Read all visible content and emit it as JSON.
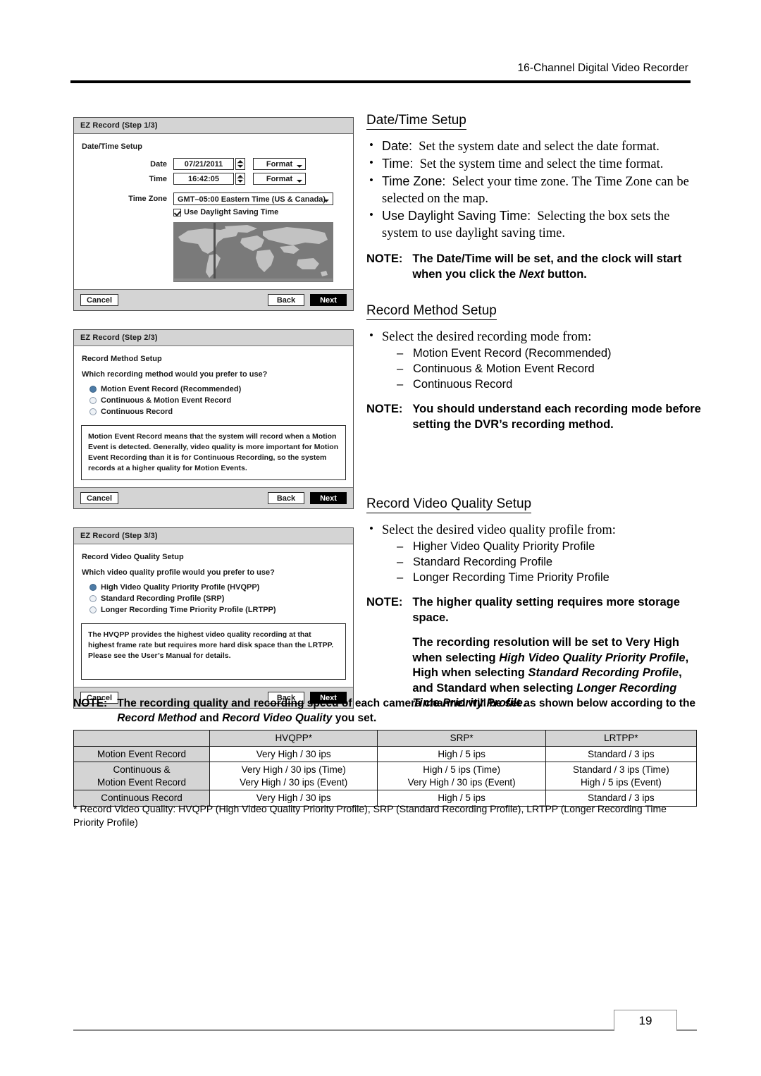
{
  "header": {
    "title": "16-Channel Digital Video Recorder"
  },
  "dialogs": [
    {
      "title": "EZ Record (Step 1/3)",
      "heading": "Date/Time Setup",
      "fields": {
        "date_label": "Date",
        "date_value": "07/21/2011",
        "time_label": "Time",
        "time_value": "16:42:05",
        "format_button": "Format",
        "timezone_label": "Time Zone",
        "timezone_value": "GMT–05:00  Eastern Time (US & Canada)",
        "dst_label": "Use Daylight Saving Time"
      },
      "buttons": {
        "cancel": "Cancel",
        "back": "Back",
        "next": "Next"
      }
    },
    {
      "title": "EZ Record (Step 2/3)",
      "heading": "Record Method Setup",
      "question": "Which recording method would you prefer to use?",
      "options": [
        {
          "label": "Motion Event Record (Recommended)",
          "selected": true
        },
        {
          "label": "Continuous & Motion Event Record",
          "selected": false
        },
        {
          "label": "Continuous Record",
          "selected": false
        }
      ],
      "description": "Motion Event Record means that the system will record when a Motion Event is detected. Generally, video quality is more important for Motion Event Recording than it is for Continuous Recording, so the system records at a higher quality for Motion Events.",
      "buttons": {
        "cancel": "Cancel",
        "back": "Back",
        "next": "Next"
      }
    },
    {
      "title": "EZ Record (Step 3/3)",
      "heading": "Record Video Quality Setup",
      "question": "Which video quality profile would you prefer to use?",
      "options": [
        {
          "label": "High Video Quality Priority Profile (HVQPP)",
          "selected": true
        },
        {
          "label": "Standard Recording Profile (SRP)",
          "selected": false
        },
        {
          "label": "Longer Recording Time Priority Profile (LRTPP)",
          "selected": false
        }
      ],
      "description": "The HVQPP provides the highest video quality recording at that highest frame rate but requires more hard disk space than the LRTPP. Please see the User’s Manual for details.",
      "buttons": {
        "cancel": "Cancel",
        "back": "Back",
        "next": "Next"
      }
    }
  ],
  "sections": [
    {
      "title": "Date/Time Setup",
      "bullets": [
        {
          "term": "Date:",
          "text": "Set the system date and select the date format."
        },
        {
          "term": "Time:",
          "text": "Set the system time and select the time format."
        },
        {
          "term": "Time Zone:",
          "text": "Select your time zone.  The Time Zone can be selected on the map."
        },
        {
          "term": "Use Daylight Saving Time:",
          "text": "Selecting the box sets the system to use daylight saving time."
        }
      ],
      "note_label": "NOTE:",
      "note_a": "The Date/Time will be set, and the clock will start when you click the ",
      "note_em": "Next",
      "note_b": " button."
    },
    {
      "title": "Record Method Setup",
      "lead": "Select the desired recording mode from:",
      "sub": [
        "Motion Event Record (Recommended)",
        "Continuous & Motion Event Record",
        "Continuous Record"
      ],
      "note_label": "NOTE:",
      "note_text": "You should understand each recording mode before setting the DVR’s recording method."
    },
    {
      "title": "Record Video Quality Setup",
      "lead": "Select the desired video quality profile from:",
      "sub": [
        "Higher Video Quality Priority Profile",
        "Standard Recording Profile",
        "Longer Recording Time Priority Profile"
      ],
      "note_label": "NOTE:",
      "note_p1": "The higher quality setting requires more storage space.",
      "note_p2_a": "The recording resolution will be set to Very High when selecting ",
      "note_p2_em1": "High Video Quality Priority Profile",
      "note_p2_b": ", High when selecting ",
      "note_p2_em2": "Standard Recording Profile",
      "note_p2_c": ", and Standard when selecting ",
      "note_p2_em3": "Longer Recording Time Priority Profile",
      "note_p2_d": "."
    }
  ],
  "bottom_note": {
    "label": "NOTE:",
    "a": "The recording quality and recording speed of each camera channel will be set as shown below according to the ",
    "em1": "Record Method",
    "b": " and ",
    "em2": "Record Video Quality",
    "c": " you set."
  },
  "table": {
    "columns": [
      "",
      "HVQPP*",
      "SRP*",
      "LRTPP*"
    ],
    "rows": [
      {
        "head": [
          "Motion Event Record"
        ],
        "cells": [
          [
            "Very High / 30 ips"
          ],
          [
            "High / 5 ips"
          ],
          [
            "Standard / 3 ips"
          ]
        ]
      },
      {
        "head": [
          "Continuous &",
          "Motion Event Record"
        ],
        "cells": [
          [
            "Very High / 30 ips (Time)",
            "Very High / 30 ips (Event)"
          ],
          [
            "High / 5 ips (Time)",
            "Very High / 30 ips (Event)"
          ],
          [
            "Standard / 3 ips (Time)",
            "High / 5 ips (Event)"
          ]
        ]
      },
      {
        "head": [
          "Continuous Record"
        ],
        "cells": [
          [
            "Very High / 30 ips"
          ],
          [
            "High / 5 ips"
          ],
          [
            "Standard / 3 ips"
          ]
        ]
      }
    ]
  },
  "footnote": "* Record Video Quality: HVQPP (High Video Quality Priority Profile), SRP (Standard Recording Profile), LRTPP (Longer Recording Time Priority Profile)",
  "page_number": "19"
}
